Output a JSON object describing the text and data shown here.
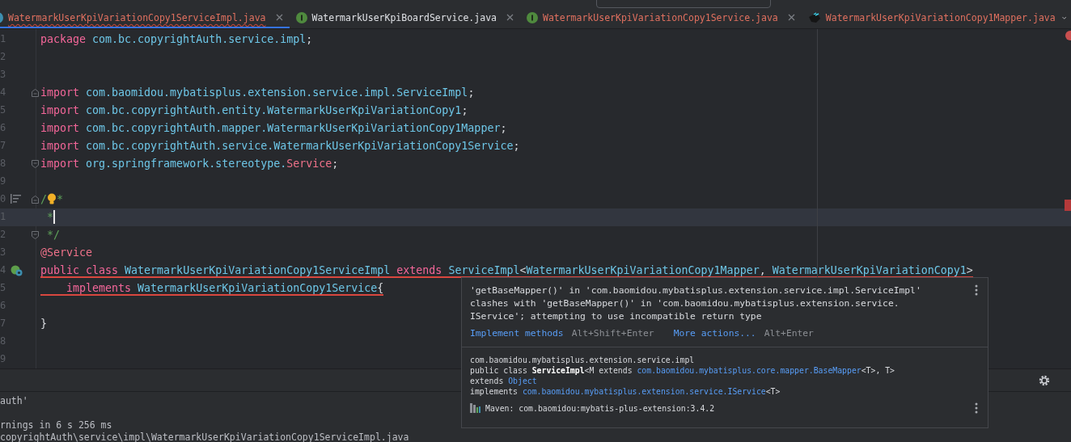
{
  "tabs": [
    {
      "label": "WatermarkUserKpiVariationCopy1ServiceImpl.java",
      "kind": "class",
      "error": true,
      "wavy_underline": true,
      "selected": true,
      "closable": true
    },
    {
      "label": "WatermarkUserKpiBoardService.java",
      "kind": "interface",
      "error": false,
      "wavy_underline": false,
      "selected": false,
      "closable": true
    },
    {
      "label": "WatermarkUserKpiVariationCopy1Service.java",
      "kind": "interface",
      "error": true,
      "wavy_underline": false,
      "selected": false,
      "closable": true
    },
    {
      "label": "WatermarkUserKpiVariationCopy1Mapper.java",
      "kind": "mapper",
      "error": true,
      "wavy_underline": false,
      "selected": false,
      "closable": false
    }
  ],
  "editor": {
    "lines": [
      {
        "number": "1",
        "current": false,
        "error": false,
        "tokens": [
          {
            "kind": "keyword",
            "text": "package "
          },
          {
            "kind": "ident",
            "text": "com.bc.copyrightAuth.service.impl"
          },
          {
            "kind": "plain",
            "text": ";"
          }
        ]
      },
      {
        "number": "2",
        "current": false
      },
      {
        "number": "3",
        "current": false
      },
      {
        "number": "4",
        "current": false,
        "error": false,
        "gutter": [
          {
            "kind": "fold_start"
          }
        ],
        "tokens": [
          {
            "kind": "keyword",
            "text": "import "
          },
          {
            "kind": "ident",
            "text": "com.baomidou.mybatisplus.extension.service.impl.ServiceImpl"
          },
          {
            "kind": "plain",
            "text": ";"
          }
        ]
      },
      {
        "number": "5",
        "current": false,
        "error": false,
        "tokens": [
          {
            "kind": "keyword",
            "text": "import "
          },
          {
            "kind": "ident",
            "text": "com.bc.copyrightAuth.entity.WatermarkUserKpiVariationCopy1"
          },
          {
            "kind": "plain",
            "text": ";"
          }
        ]
      },
      {
        "number": "6",
        "current": false,
        "error": false,
        "tokens": [
          {
            "kind": "keyword",
            "text": "import "
          },
          {
            "kind": "ident",
            "text": "com.bc.copyrightAuth.mapper.WatermarkUserKpiVariationCopy1Mapper"
          },
          {
            "kind": "plain",
            "text": ";"
          }
        ]
      },
      {
        "number": "7",
        "current": false,
        "error": false,
        "tokens": [
          {
            "kind": "keyword",
            "text": "import "
          },
          {
            "kind": "ident",
            "text": "com.bc.copyrightAuth.service.WatermarkUserKpiVariationCopy1Service"
          },
          {
            "kind": "plain",
            "text": ";"
          }
        ]
      },
      {
        "number": "8",
        "current": false,
        "error": false,
        "gutter": [
          {
            "kind": "fold_end"
          }
        ],
        "tokens": [
          {
            "kind": "keyword",
            "text": "import "
          },
          {
            "kind": "ident",
            "text": "org.springframework.stereotype."
          },
          {
            "kind": "annotation",
            "text": "Service"
          },
          {
            "kind": "plain",
            "text": ";"
          }
        ]
      },
      {
        "number": "9",
        "current": false
      },
      {
        "number": "0",
        "current": false,
        "error": false,
        "gutter": [
          {
            "kind": "structure"
          },
          {
            "kind": "fold_start"
          }
        ],
        "tokens": [
          {
            "kind": "comment",
            "text": "/"
          },
          {
            "kind": "bulb"
          },
          {
            "kind": "comment",
            "text": "*"
          }
        ]
      },
      {
        "number": "1",
        "current": true,
        "error": false,
        "tokens": [
          {
            "kind": "comment",
            "text": " *"
          },
          {
            "kind": "caret"
          }
        ]
      },
      {
        "number": "2",
        "current": false,
        "error": false,
        "gutter": [
          {
            "kind": "fold_end"
          }
        ],
        "tokens": [
          {
            "kind": "comment",
            "text": " */"
          }
        ]
      },
      {
        "number": "3",
        "current": false,
        "error": false,
        "tokens": [
          {
            "kind": "annotation",
            "text": "@Service"
          }
        ]
      },
      {
        "number": "4",
        "current": false,
        "error": true,
        "gutter": [
          {
            "kind": "implemented"
          }
        ],
        "tokens": [
          {
            "kind": "keyword",
            "text": "public class "
          },
          {
            "kind": "ident",
            "text": "WatermarkUserKpiVariationCopy1ServiceImpl"
          },
          {
            "kind": "keyword",
            "text": " extends "
          },
          {
            "kind": "ident",
            "text": "ServiceImpl"
          },
          {
            "kind": "plain",
            "text": "<"
          },
          {
            "kind": "ident",
            "text": "WatermarkUserKpiVariationCopy1Mapper"
          },
          {
            "kind": "plain",
            "text": ", "
          },
          {
            "kind": "ident",
            "text": "WatermarkUserKpiVariationCopy1"
          },
          {
            "kind": "plain",
            "text": ">"
          }
        ]
      },
      {
        "number": "5",
        "current": false,
        "error": true,
        "tokens": [
          {
            "kind": "keyword",
            "text": "    implements "
          },
          {
            "kind": "ident",
            "text": "WatermarkUserKpiVariationCopy1Service"
          },
          {
            "kind": "plain",
            "text": "{"
          }
        ]
      },
      {
        "number": "6",
        "current": false
      },
      {
        "number": "7",
        "current": false,
        "error": false,
        "tokens": [
          {
            "kind": "plain",
            "text": "}"
          }
        ]
      },
      {
        "number": "8",
        "current": false
      },
      {
        "number": "9",
        "current": false
      }
    ]
  },
  "popup": {
    "message": "'getBaseMapper()' in 'com.baomidou.mybatisplus.extension.service.impl.ServiceImpl'\nclashes with 'getBaseMapper()' in 'com.baomidou.mybatisplus.extension.service.\nIService'; attempting to use incompatible return type",
    "actions": [
      {
        "label": "Implement methods",
        "shortcut": "Alt+Shift+Enter"
      },
      {
        "label": "More actions...",
        "shortcut": "Alt+Enter"
      }
    ],
    "doc_lines": [
      [
        {
          "kind": "text",
          "text": "com.baomidou.mybatisplus.extension.service.impl"
        }
      ],
      [
        {
          "kind": "text",
          "text": "public class **ServiceImpl**<M extends "
        },
        {
          "kind": "link",
          "text": "com.baomidou.mybatisplus.core.mapper.BaseMapper"
        },
        {
          "kind": "text",
          "text": "<T>, T>"
        }
      ],
      [
        {
          "kind": "text",
          "text": "extends "
        },
        {
          "kind": "link",
          "text": "Object"
        }
      ],
      [
        {
          "kind": "text",
          "text": "implements "
        },
        {
          "kind": "link",
          "text": "com.baomidou.mybatisplus.extension.service.IService"
        },
        {
          "kind": "text",
          "text": "<T>"
        }
      ]
    ],
    "library": "Maven: com.baomidou:mybatis-plus-extension:3.4.2"
  },
  "output": [
    "auth'",
    "rnings in 6 s 256 ms",
    "copyrightAuth\\service\\impl\\WatermarkUserKpiVariationCopy1ServiceImpl.java"
  ]
}
